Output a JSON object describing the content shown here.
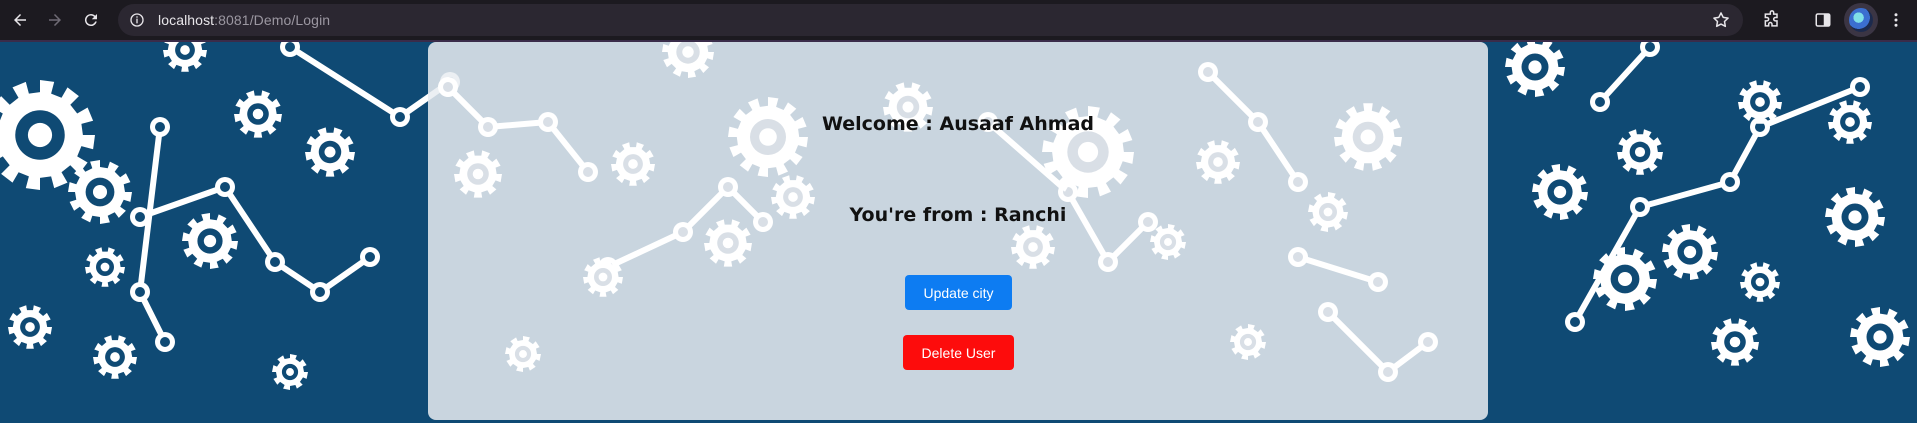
{
  "browser": {
    "url_host": "localhost",
    "url_path": ":8081/Demo/Login",
    "icons": [
      "back-arrow-icon",
      "forward-arrow-icon",
      "reload-icon",
      "site-info-icon",
      "bookmark-star-icon",
      "extensions-icon",
      "side-panel-icon",
      "profile-avatar",
      "more-menu-icon"
    ]
  },
  "card": {
    "welcome_text": "Welcome : Ausaaf Ahmad",
    "from_text": "You're from : Ranchi",
    "update_button_label": "Update city",
    "delete_button_label": "Delete User"
  },
  "colors": {
    "page_background": "#0f4a74",
    "card_background": "#e8ecf1",
    "update_button": "#0d7cf2",
    "delete_button": "#fd0c0c",
    "browser_bar": "#1c1a20"
  }
}
